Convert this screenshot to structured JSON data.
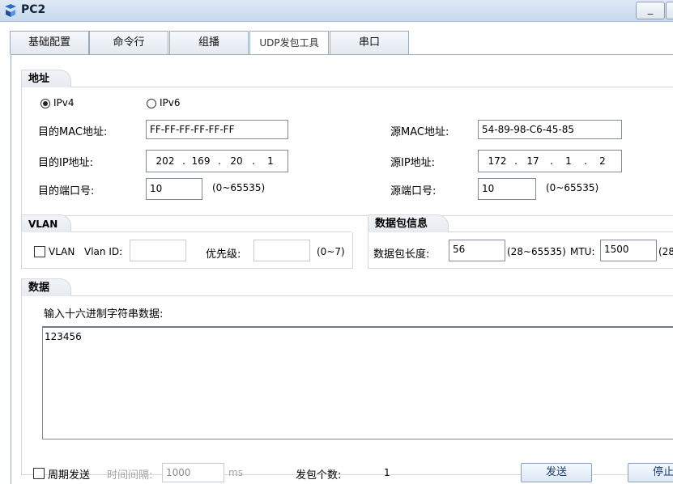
{
  "window": {
    "title": "PC2",
    "minimize_label": "_"
  },
  "tabs": [
    {
      "label": "基础配置",
      "active": false
    },
    {
      "label": "命令行",
      "active": false
    },
    {
      "label": "组播",
      "active": false
    },
    {
      "label": "UDP发包工具",
      "active": true
    },
    {
      "label": "串口",
      "active": false
    }
  ],
  "address": {
    "header": "地址",
    "ipv4_label": "IPv4",
    "ipv6_label": "IPv6",
    "selected": "IPv4",
    "dst_mac_label": "目的MAC地址:",
    "dst_mac_value": "FF-FF-FF-FF-FF-FF",
    "src_mac_label": "源MAC地址:",
    "src_mac_value": "54-89-98-C6-45-85",
    "dst_ip_label": "目的IP地址:",
    "dst_ip": [
      "202",
      "169",
      "20",
      "1"
    ],
    "src_ip_label": "源IP地址:",
    "src_ip": [
      "172",
      "17",
      "1",
      "2"
    ],
    "dst_port_label": "目的端口号:",
    "dst_port_value": "10",
    "dst_port_range": "(0~65535)",
    "src_port_label": "源端口号:",
    "src_port_value": "10",
    "src_port_range": "(0~65535)",
    "ip_dot": "."
  },
  "vlan": {
    "header": "VLAN",
    "checkbox_label": "VLAN",
    "vlan_id_label": "Vlan ID:",
    "vlan_id_value": "",
    "priority_label": "优先级:",
    "priority_value": "",
    "priority_range": "(0~7)"
  },
  "packet_info": {
    "header": "数据包信息",
    "length_label": "数据包长度:",
    "length_value": "56",
    "length_range": "(28~65535)",
    "mtu_label": "MTU:",
    "mtu_value": "1500",
    "mtu_range": "(28"
  },
  "data": {
    "header": "数据",
    "prompt": "输入十六进制字符串数据:",
    "value": "123456"
  },
  "footer": {
    "periodic_label": "周期发送",
    "interval_label": "时间间隔:",
    "interval_value": "1000",
    "interval_unit": "ms",
    "count_label": "发包个数:",
    "count_value": "1",
    "send_button": "发送",
    "stop_button": "停止"
  }
}
